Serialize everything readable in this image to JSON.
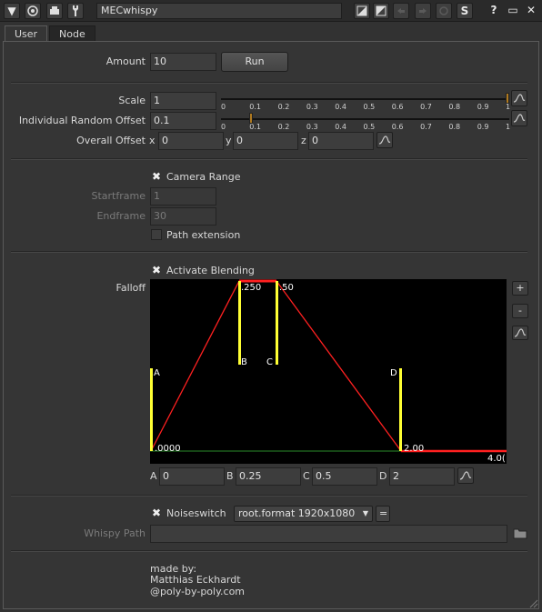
{
  "node": {
    "name": "MECwhispy",
    "icons": [
      "collapse-arrow-icon",
      "node-target-icon",
      "viewer-icon",
      "wrench-icon",
      "mask-left-icon",
      "mask-right-icon",
      "undo-icon",
      "redo-icon",
      "revert-icon",
      "script-icon",
      "help-icon",
      "float-panel-icon",
      "close-icon"
    ],
    "toolbar_glyphs": {
      "collapse": "▼",
      "help": "?",
      "float": "▭",
      "close": "✕",
      "script": "S"
    }
  },
  "tabs": [
    {
      "label": "User",
      "active": true
    },
    {
      "label": "Node",
      "active": false
    }
  ],
  "amount": {
    "label": "Amount",
    "value": "10",
    "run_label": "Run"
  },
  "scale": {
    "label": "Scale",
    "value": "1",
    "slider_fraction": 1.0
  },
  "random_offset": {
    "label": "Individual Random Offset",
    "value": "0.1",
    "slider_fraction": 0.1
  },
  "slider_ticks": [
    "0",
    "0.1",
    "0.2",
    "0.3",
    "0.4",
    "0.5",
    "0.6",
    "0.7",
    "0.8",
    "0.9",
    "1"
  ],
  "overall_offset": {
    "label": "Overall Offset",
    "x_label": "x",
    "x": "0",
    "y_label": "y",
    "y": "0",
    "z_label": "z",
    "z": "0"
  },
  "camera_range": {
    "label": "Camera Range",
    "checked": true
  },
  "startframe": {
    "label": "Startframe",
    "value": "1"
  },
  "endframe": {
    "label": "Endframe",
    "value": "30"
  },
  "path_extension": {
    "label": "Path extension",
    "checked": false
  },
  "activate_blending": {
    "label": "Activate Blending",
    "checked": true
  },
  "falloff": {
    "label": "Falloff",
    "side_buttons": {
      "add": "+",
      "remove": "-"
    },
    "a_label": "A",
    "a": "0",
    "b_label": "B",
    "b": "0.25",
    "c_label": "C",
    "c": "0.5",
    "d_label": "D",
    "d": "2",
    "graph_labels": {
      "a_value": ".0000",
      "b_value": ".250",
      "c_value": ".50",
      "d_value": "2.00",
      "x_end": "4.0("
    },
    "colors": {
      "background": "#000000",
      "curve": "#ff2020",
      "markers": "#ffff33",
      "baseline": "#2a8a2a"
    }
  },
  "noiseswitch": {
    "label": "Noiseswitch",
    "checked": true,
    "format": "root.format 1920x1080",
    "equals": "="
  },
  "whispy_path": {
    "label": "Whispy Path",
    "value": ""
  },
  "credits": {
    "line1": "made by:",
    "line2": "Matthias Eckhardt",
    "line3": "@poly-by-poly.com"
  }
}
